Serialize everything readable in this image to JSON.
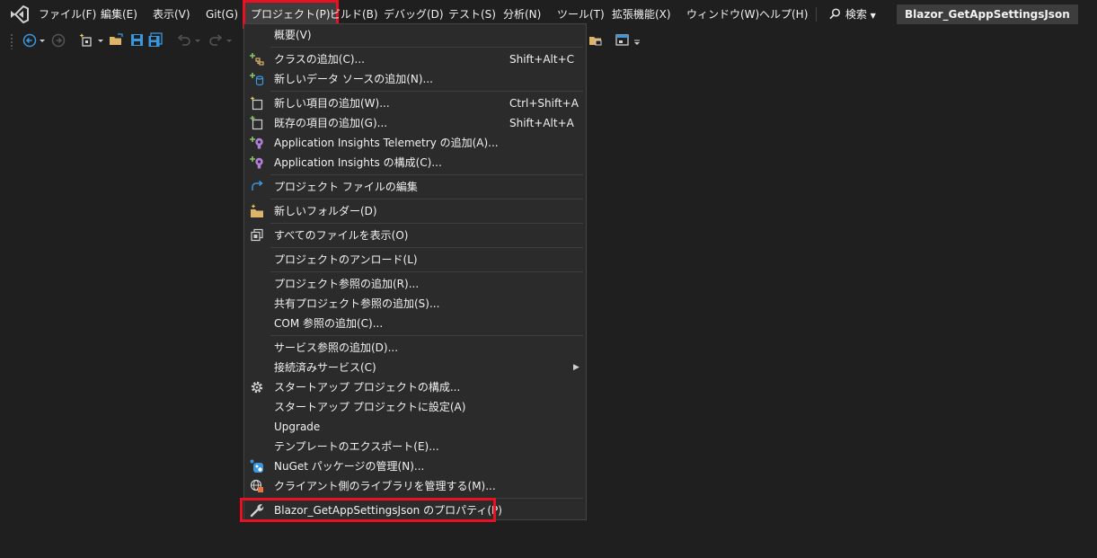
{
  "menubar": {
    "items": [
      {
        "id": "file",
        "label": "ファイル(F)"
      },
      {
        "id": "edit",
        "label": "編集(E)"
      },
      {
        "id": "view",
        "label": "表示(V)"
      },
      {
        "id": "git",
        "label": "Git(G)"
      },
      {
        "id": "project",
        "label": "プロジェクト(P)"
      },
      {
        "id": "build",
        "label": "ビルド(B)"
      },
      {
        "id": "debug",
        "label": "デバッグ(D)"
      },
      {
        "id": "test",
        "label": "テスト(S)"
      },
      {
        "id": "analyze",
        "label": "分析(N)"
      },
      {
        "id": "tools",
        "label": "ツール(T)"
      },
      {
        "id": "extensions",
        "label": "拡張機能(X)"
      },
      {
        "id": "window",
        "label": "ウィンドウ(W)"
      },
      {
        "id": "help",
        "label": "ヘルプ(H)"
      }
    ],
    "search_label": "検索",
    "solution_title": "Blazor_GetAppSettingsJson"
  },
  "project_menu": {
    "items": [
      {
        "label": "概要(V)",
        "icon": "none",
        "shortcut": ""
      },
      {
        "label": "クラスの追加(C)...",
        "icon": "add-class-icon",
        "shortcut": "Shift+Alt+C"
      },
      {
        "label": "新しいデータ ソースの追加(N)...",
        "icon": "add-datasource-icon",
        "shortcut": ""
      },
      {
        "label": "新しい項目の追加(W)...",
        "icon": "new-item-icon",
        "shortcut": "Ctrl+Shift+A"
      },
      {
        "label": "既存の項目の追加(G)...",
        "icon": "existing-item-icon",
        "shortcut": "Shift+Alt+A"
      },
      {
        "label": "Application Insights Telemetry の追加(A)...",
        "icon": "app-insights-icon",
        "shortcut": ""
      },
      {
        "label": "Application Insights の構成(C)...",
        "icon": "app-insights-icon",
        "shortcut": ""
      },
      {
        "label": "プロジェクト ファイルの編集",
        "icon": "edit-project-icon",
        "shortcut": ""
      },
      {
        "label": "新しいフォルダー(D)",
        "icon": "new-folder-icon",
        "shortcut": ""
      },
      {
        "label": "すべてのファイルを表示(O)",
        "icon": "show-all-files-icon",
        "shortcut": ""
      },
      {
        "label": "プロジェクトのアンロード(L)",
        "icon": "none",
        "shortcut": ""
      },
      {
        "label": "プロジェクト参照の追加(R)...",
        "icon": "none",
        "shortcut": ""
      },
      {
        "label": "共有プロジェクト参照の追加(S)...",
        "icon": "none",
        "shortcut": ""
      },
      {
        "label": "COM 参照の追加(C)...",
        "icon": "none",
        "shortcut": ""
      },
      {
        "label": "サービス参照の追加(D)...",
        "icon": "none",
        "shortcut": ""
      },
      {
        "label": "接続済みサービス(C)",
        "icon": "none",
        "shortcut": ""
      },
      {
        "label": "スタートアップ プロジェクトの構成...",
        "icon": "gear-icon",
        "shortcut": ""
      },
      {
        "label": "スタートアップ プロジェクトに設定(A)",
        "icon": "none",
        "shortcut": ""
      },
      {
        "label": "Upgrade",
        "icon": "none",
        "shortcut": ""
      },
      {
        "label": "テンプレートのエクスポート(E)...",
        "icon": "none",
        "shortcut": ""
      },
      {
        "label": "NuGet パッケージの管理(N)...",
        "icon": "nuget-icon",
        "shortcut": ""
      },
      {
        "label": "クライアント側のライブラリを管理する(M)...",
        "icon": "client-library-icon",
        "shortcut": ""
      },
      {
        "label": "Blazor_GetAppSettingsJson のプロパティ(P)",
        "icon": "wrench-icon",
        "shortcut": ""
      }
    ]
  },
  "colors": {
    "background": "#1f1f1f",
    "menu_background": "#2b2b2b",
    "highlight": "#e81123",
    "accent": "#3a96dd"
  }
}
